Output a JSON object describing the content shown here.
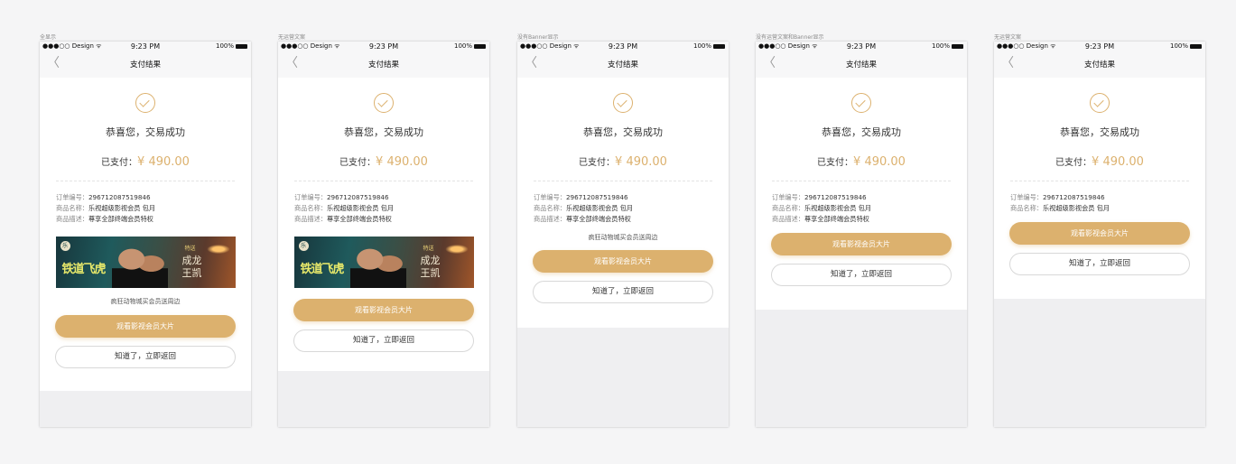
{
  "screens": [
    {
      "caption": "全显示",
      "show_banner": true,
      "show_promo": true
    },
    {
      "caption": "无运营文案",
      "show_banner": true,
      "show_promo": false
    },
    {
      "caption": "没有Banner显示",
      "show_banner": false,
      "show_promo": true
    },
    {
      "caption": "没有运营文案和Banner显示",
      "show_banner": false,
      "show_promo": false
    },
    {
      "caption": "无运营文案",
      "show_banner": false,
      "show_promo": false,
      "show_desc": false
    }
  ],
  "status": {
    "carrier": "●●●○○ Design ᯤ",
    "time": "9:23 PM",
    "battery": "100%"
  },
  "nav": {
    "back": "〈",
    "title": "支付结果"
  },
  "result": {
    "message": "恭喜您，交易成功",
    "paid_label": "已支付：",
    "paid_amount": "¥ 490.00"
  },
  "order": {
    "number_label": "订单编号：",
    "number": "296712087519846",
    "name_label": "商品名称：",
    "name": "乐视超级影视会员 包月",
    "desc_label": "商品描述：",
    "desc": "尊享全部终端会员特权"
  },
  "banner": {
    "logo": "乐",
    "title": "铁道飞虎",
    "tag": "特送",
    "names": "成龙\n王凯"
  },
  "promo_text": "疯狂动物城买会员送周边",
  "buttons": {
    "watch": "观看影视会员大片",
    "return": "知道了，立即返回"
  },
  "colors": {
    "accent": "#dcb16e",
    "background": "#f5f5f6"
  }
}
